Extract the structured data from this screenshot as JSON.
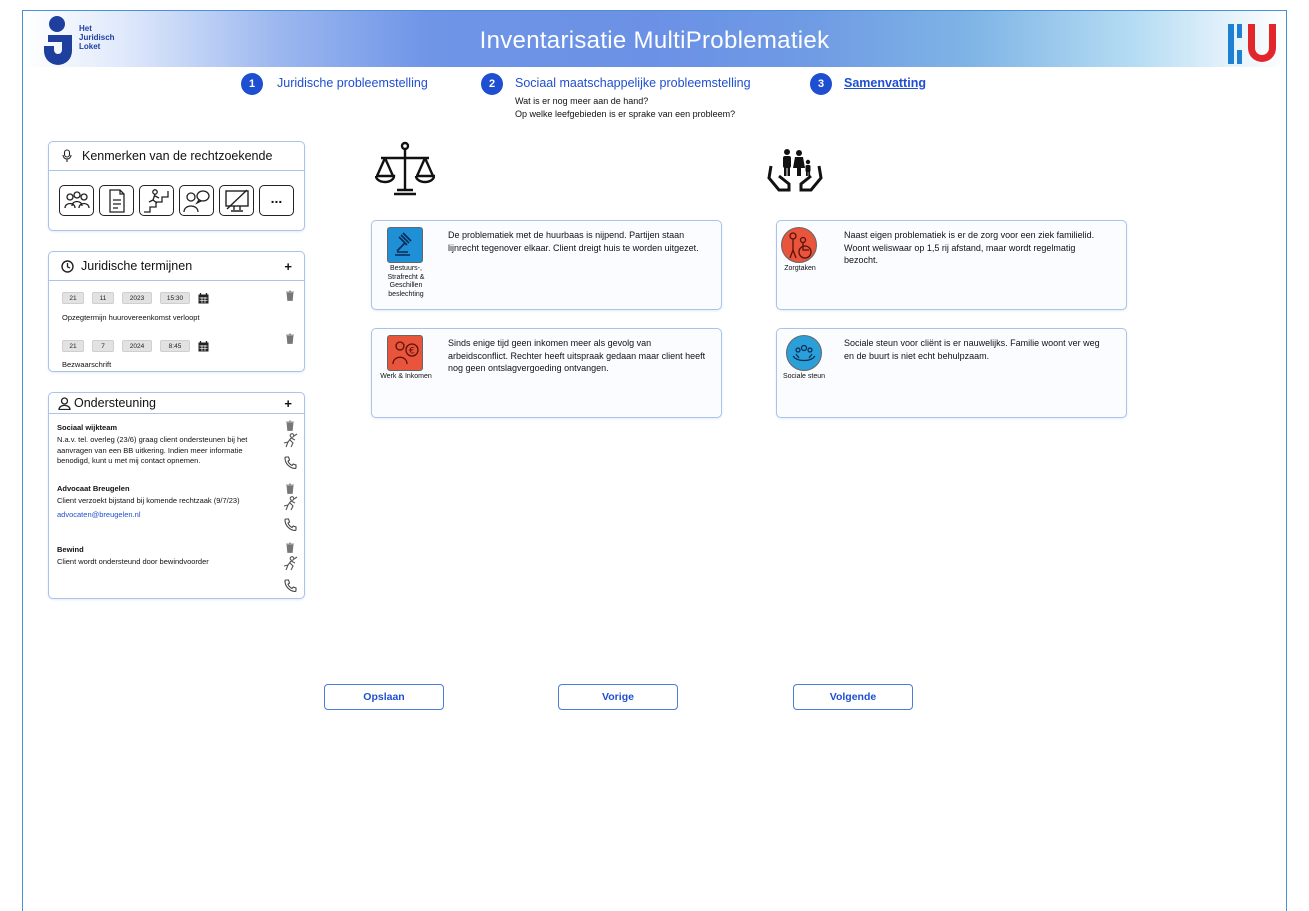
{
  "header": {
    "title": "Inventarisatie MultiProblematiek",
    "logo_left_text": [
      "Het",
      "Juridisch",
      "Loket"
    ]
  },
  "steps": [
    {
      "num": "1",
      "label": "Juridische probleemstelling"
    },
    {
      "num": "2",
      "label": "Sociaal maatschappelijke probleemstelling",
      "sub1": "Wat is er nog meer aan de hand?",
      "sub2": "Op welke leefgebieden is er sprake van een probleem?"
    },
    {
      "num": "3",
      "label": "Samenvatting"
    }
  ],
  "kenmerken": {
    "title": "Kenmerken van de rechtzoekende",
    "more": "..."
  },
  "termijnen": {
    "title": "Juridische termijnen",
    "add": "+",
    "items": [
      {
        "day": "21",
        "month": "11",
        "year": "2023",
        "time": "15:30",
        "label": "Opzegtermijn huurovereenkomst verloopt"
      },
      {
        "day": "21",
        "month": "7",
        "year": "2024",
        "time": "8:45",
        "label": "Bezwaarschrift"
      }
    ]
  },
  "ondersteuning": {
    "title": "Ondersteuning",
    "add": "+",
    "items": [
      {
        "name": "Sociaal wijkteam",
        "text": "N.a.v. tel. overleg (23/6) graag client ondersteunen bij het aanvragen van een BB uitkering. Indien meer informatie benodigd, kunt u met mij contact opnemen.",
        "link": ""
      },
      {
        "name": "Advocaat Breugelen",
        "text": "Client verzoekt bijstand bij komende rechtzaak (9/7/23)",
        "link": "advocaten@breugelen.nl"
      },
      {
        "name": "Bewind",
        "text": "Client wordt ondersteund door bewindvoorder",
        "link": ""
      }
    ]
  },
  "problems_left": [
    {
      "category": "Bestuurs-, Strafrecht & Geschillen beslechting",
      "text": "De problematiek met de huurbaas is nijpend. Partijen staan lijnrecht tegenover elkaar. Client dreigt huis te worden uitgezet.",
      "color": "#1f8fd6"
    },
    {
      "category": "Werk & Inkomen",
      "text": "Sinds enige tijd geen inkomen meer als gevolg van arbeidsconflict. Rechter heeft uitspraak gedaan maar client heeft nog geen ontslagvergoeding ontvangen.",
      "color": "#e8543c"
    }
  ],
  "problems_right": [
    {
      "category": "Zorgtaken",
      "text": "Naast eigen problematiek is er de zorg voor een ziek familielid. Woont weliswaar op 1,5 rij afstand, maar wordt regelmatig bezocht.",
      "color": "#e8543c"
    },
    {
      "category": "Sociale steun",
      "text": "Sociale steun voor cliënt is er nauwelijks. Familie woont ver weg en de buurt is niet echt behulpzaam.",
      "color": "#2a9fd8"
    }
  ],
  "buttons": {
    "save": "Opslaan",
    "prev": "Vorige",
    "next": "Volgende"
  }
}
